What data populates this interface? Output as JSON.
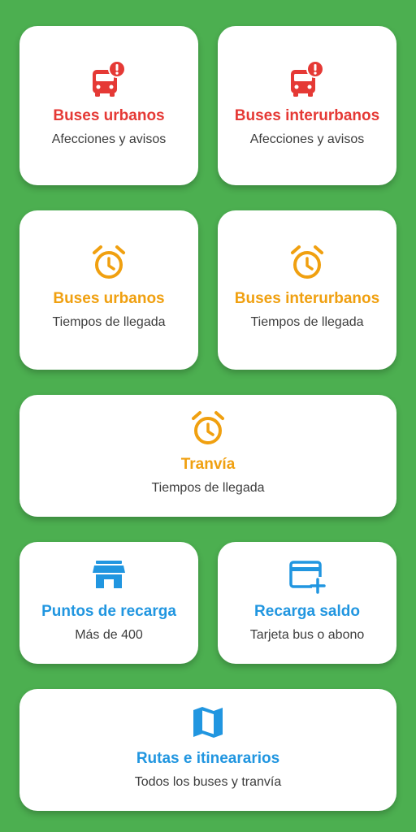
{
  "colors": {
    "background": "#4caf50",
    "card": "#ffffff",
    "red": "#e53935",
    "orange": "#f0a010",
    "blue": "#2196e0",
    "subtitle": "#3d3d3d"
  },
  "cards": [
    {
      "icon": "bus-alert-icon",
      "title": "Buses urbanos",
      "subtitle": "Afecciones y avisos"
    },
    {
      "icon": "bus-alert-icon",
      "title": "Buses interurbanos",
      "subtitle": "Afecciones y avisos"
    },
    {
      "icon": "alarm-clock-icon",
      "title": "Buses urbanos",
      "subtitle": "Tiempos de llegada"
    },
    {
      "icon": "alarm-clock-icon",
      "title": "Buses interurbanos",
      "subtitle": "Tiempos de llegada"
    },
    {
      "icon": "alarm-clock-icon",
      "title": "Tranvía",
      "subtitle": "Tiempos de llegada"
    },
    {
      "icon": "store-icon",
      "title": "Puntos de recarga",
      "subtitle": "Más de 400"
    },
    {
      "icon": "credit-card-plus-icon",
      "title": "Recarga saldo",
      "subtitle": "Tarjeta bus o abono"
    },
    {
      "icon": "map-icon",
      "title": "Rutas e itineararios",
      "subtitle": "Todos los buses y tranvía"
    }
  ]
}
